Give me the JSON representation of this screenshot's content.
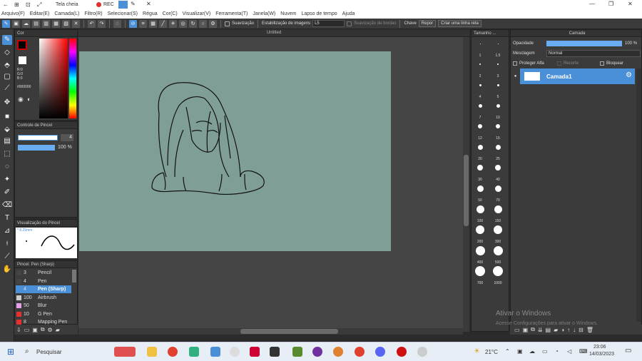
{
  "titlebar": {
    "mode_label": "Tela cheia",
    "rec_label": "REC"
  },
  "menu": [
    "Arquivo(F)",
    "Editar(E)",
    "Camada(L)",
    "Filtro(R)",
    "Selecionar(S)",
    "Régua",
    "Cor(C)",
    "Visualizar(V)",
    "Ferramenta(T)",
    "Janela(W)",
    "Nuvem",
    "Lapso de tempo",
    "Ajuda"
  ],
  "toolbar": {
    "smoothing_label": "Suavização",
    "stabilization_label": "Estabilização de imagens",
    "stabilization_value": "L5",
    "edge_smoothing_label": "Suavização de bordas",
    "key_label": "Chave",
    "reset_label": "Repor",
    "new_line_layer_label": "Criar uma linha reta"
  },
  "color_panel": {
    "title": "Cor",
    "r": "R:0",
    "g": "G:0",
    "b": "B:0",
    "hex": "#000000"
  },
  "brush_control": {
    "title": "Controle de Pincel",
    "size_value": "4",
    "opacity_value": "100 %"
  },
  "brush_preview": {
    "title": "Visualização do Pincel",
    "size_text": "* 8.29mm"
  },
  "brush_list": {
    "title": "Pincel: Pen (Sharp)",
    "items": [
      {
        "size": "3",
        "name": "Pencil",
        "color": "#444444"
      },
      {
        "size": "4",
        "name": "Pen",
        "color": "#444444"
      },
      {
        "size": "4",
        "name": "Pen (Sharp)",
        "color": "#4a90d9"
      },
      {
        "size": "100",
        "name": "Airbrush",
        "color": "#cccccc"
      },
      {
        "size": "50",
        "name": "Blur",
        "color": "#e8a0e8"
      },
      {
        "size": "10",
        "name": "G Pen",
        "color": "#e83030"
      },
      {
        "size": "8",
        "name": "Mapping Pen",
        "color": "#e83030"
      }
    ]
  },
  "canvas": {
    "tab_title": "Untitled"
  },
  "size_panel": {
    "title": "Tamanho ...",
    "sizes": [
      "1",
      "1.5",
      "2",
      "3",
      "4",
      "5",
      "7",
      "10",
      "12",
      "15",
      "20",
      "25",
      "30",
      "40",
      "50",
      "70",
      "100",
      "150",
      "200",
      "300",
      "400",
      "500",
      "700",
      "1000"
    ]
  },
  "layer_panel": {
    "title": "Camada",
    "opacity_label": "Opacidade",
    "opacity_value": "100 %",
    "blend_label": "Mesclagem",
    "blend_value": "Normal",
    "protect_alpha": "Proteger Alfa",
    "clipping": "Recorte",
    "lock": "Bloquear",
    "layer_name": "Camada1"
  },
  "watermark": {
    "line1": "Ativar o Windows",
    "line2": "Acesse Configurações para ativar o Windows."
  },
  "taskbar": {
    "search_label": "Pesquisar",
    "weather": "21°C",
    "time": "23:06",
    "date": "14/03/2023"
  }
}
